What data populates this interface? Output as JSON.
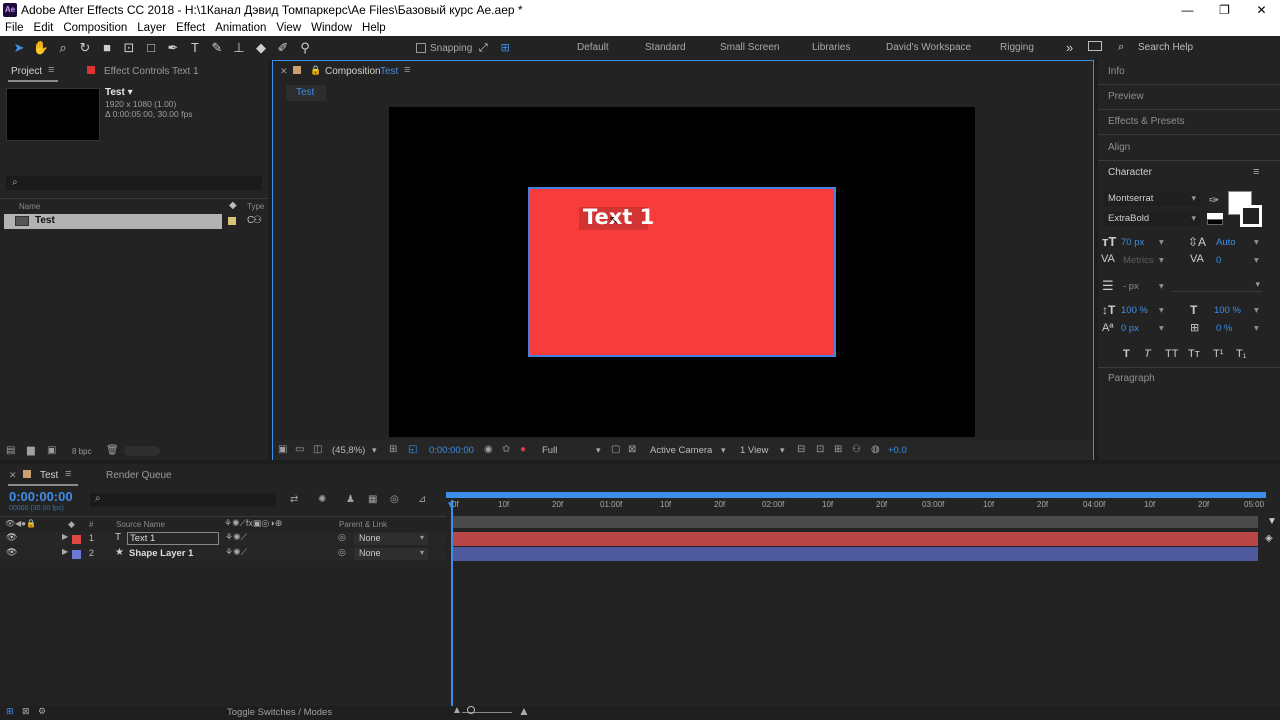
{
  "titlebar": {
    "app_icon": "Ae",
    "title": "Adobe After Effects CC 2018 - H:\\1Канал Дэвид Томпаркерс\\Ae Files\\Базовый курс Ae.aep *",
    "minimize": "—",
    "maximize": "❐",
    "close": "✕"
  },
  "menu": [
    "File",
    "Edit",
    "Composition",
    "Layer",
    "Effect",
    "Animation",
    "View",
    "Window",
    "Help"
  ],
  "toolbar": {
    "snapping": "Snapping",
    "workspaces": [
      "Default",
      "Standard",
      "Small Screen",
      "Libraries",
      "David's Workspace",
      "Rigging"
    ],
    "more": "»",
    "search_placeholder": "Search Help"
  },
  "project": {
    "tab_project": "Project",
    "tab_effect_controls": "Effect Controls Text 1",
    "item_name": "Test ▾",
    "item_res": "1920 x 1080 (1.00)",
    "item_dur": "Δ 0:00:05:00, 30.00 fps",
    "search_icon": "⌕",
    "col_name": "Name",
    "col_type": "Type",
    "row_name": "Test",
    "row_type": "C",
    "bpc": "8 bpc"
  },
  "composition": {
    "tab_prefix": "Composition",
    "tab_name": "Test",
    "subtab": "Test",
    "text_layer": "Text 1",
    "zoom": "(45,8%)",
    "time": "0:00:00:00",
    "resolution": "Full",
    "camera": "Active Camera",
    "view": "1 View",
    "exposure": "+0.0",
    "colors": {
      "shape_fill": "#f83c3c",
      "frame_border": "#4a7fe0",
      "text": "#ffffff"
    }
  },
  "right_panel": {
    "info": "Info",
    "preview": "Preview",
    "effects_presets": "Effects & Presets",
    "align": "Align",
    "character": "Character",
    "font_family": "Montserrat",
    "font_style": "ExtraBold",
    "font_size": "70 px",
    "leading": "Auto",
    "kerning": "Metrics",
    "tracking": "0",
    "stroke_unit": "- px",
    "vscale": "100 %",
    "hscale": "100 %",
    "baseline": "0 px",
    "tsume": "0 %",
    "style_buttons": [
      "T",
      "T",
      "TT",
      "Tт",
      "T¹",
      "T₁"
    ],
    "paragraph": "Paragraph"
  },
  "timeline": {
    "tab_comp": "Test",
    "tab_render": "Render Queue",
    "timecode": "0:00:00:00",
    "timecode_sub": "00000 (30.00 fps)",
    "col_hash": "#",
    "col_source": "Source Name",
    "col_parent": "Parent & Link",
    "ruler": [
      "0f",
      "10f",
      "20f",
      "01:00f",
      "10f",
      "20f",
      "02:00f",
      "10f",
      "20f",
      "03:00f",
      "10f",
      "20f",
      "04:00f",
      "10f",
      "20f",
      "05:00"
    ],
    "layers": [
      {
        "num": "1",
        "type_icon": "T",
        "name": "Text 1",
        "parent": "None",
        "label_color": "#e04848",
        "bar_color": "#b84646"
      },
      {
        "num": "2",
        "type_icon": "★",
        "name": "Shape Layer 1",
        "parent": "None",
        "label_color": "#6a79d8",
        "bar_color": "#4f5a9e"
      }
    ],
    "toggle_label": "Toggle Switches / Modes"
  }
}
